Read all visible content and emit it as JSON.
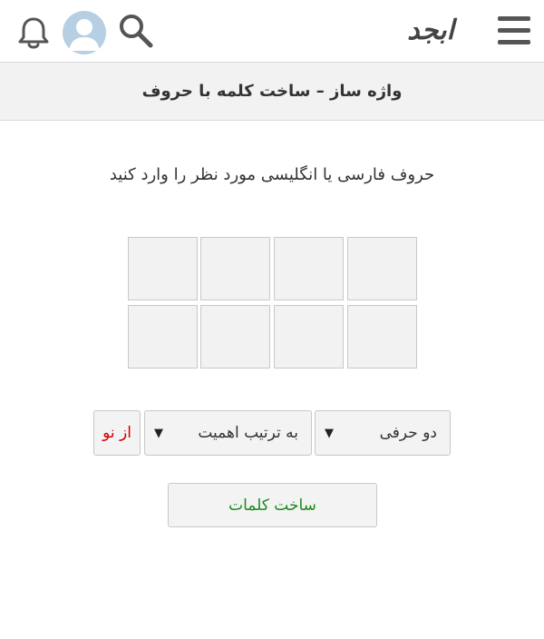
{
  "header": {
    "logo_text": "ابجد",
    "icons": [
      "bell-icon",
      "avatar",
      "search-icon",
      "logo",
      "menu-icon"
    ],
    "avatar_color": "#b6cfe3"
  },
  "page": {
    "title": "واژه ساز – ساخت کلمه با حروف",
    "instruction": "حروف فارسی یا انگلیسی مورد نظر را وارد کنید"
  },
  "letter_grid": {
    "cells": [
      "",
      "",
      "",
      "",
      "",
      "",
      "",
      ""
    ]
  },
  "controls": {
    "letter_count_select": {
      "selected": "دو حرفی"
    },
    "order_select": {
      "selected": "به ترتیب اهمیت"
    },
    "reset_label": "از نو",
    "build_label": "ساخت کلمات"
  },
  "colors": {
    "reset": "#d20000",
    "build": "#1a8a1a"
  }
}
